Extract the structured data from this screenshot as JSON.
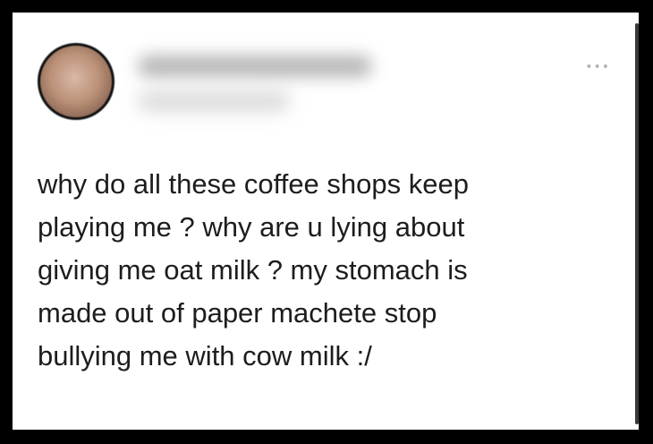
{
  "post": {
    "more_options_icon": "more-horizontal-icon",
    "more_options_glyph": "•••",
    "text": "why do all these coffee shops keep\nplaying me ? why are u lying about\ngiving me oat milk ? my stomach is\nmade out of paper machete stop\nbullying me with cow milk :/"
  },
  "colors": {
    "frame": "#000000",
    "card": "#ffffff",
    "text": "#1d1d1d"
  }
}
